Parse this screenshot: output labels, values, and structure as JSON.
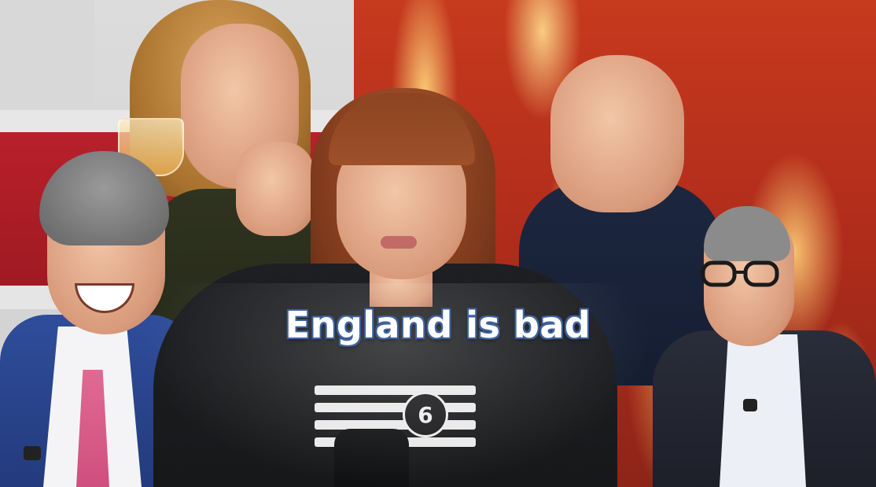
{
  "caption": {
    "text": "England is bad"
  },
  "shirt": {
    "badge_number": "6"
  },
  "colors": {
    "caption_fill": "#ffffff",
    "caption_outline": "#3e5f9a",
    "fire": "#c63a1e",
    "flag_red": "#b8202a",
    "flag_blue": "#2a3c86"
  }
}
